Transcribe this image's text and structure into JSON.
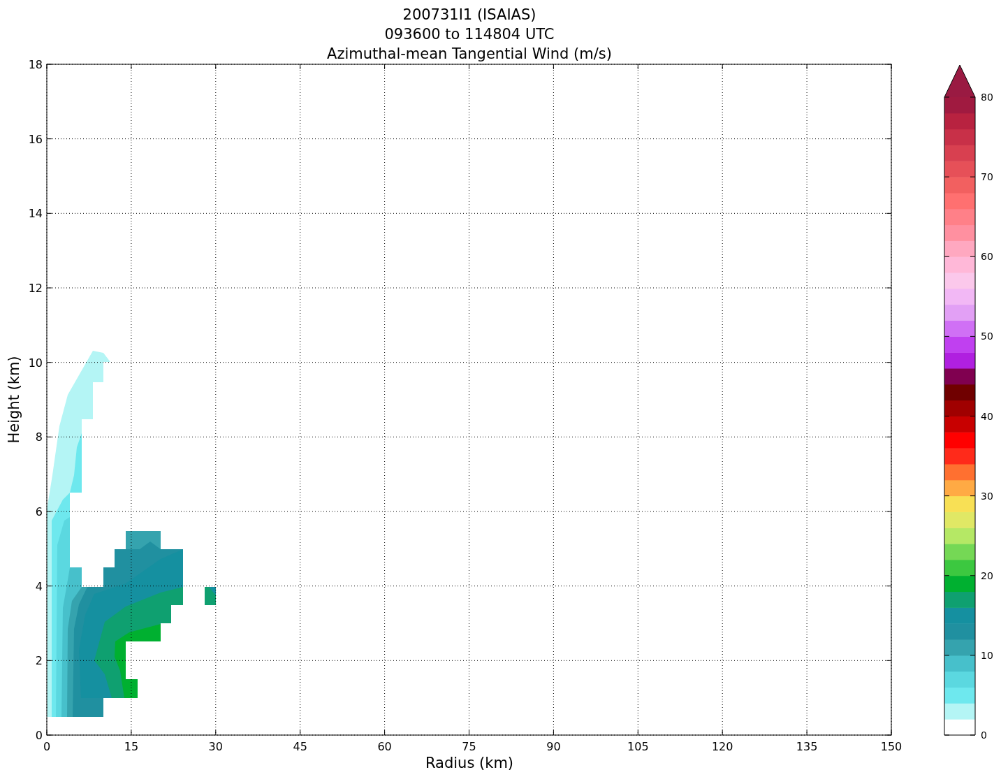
{
  "title_lines": [
    "200731I1 (ISAIAS)",
    "093600 to 114804 UTC",
    "Azimuthal-mean Tangential Wind (m/s)"
  ],
  "xlabel": "Radius (km)",
  "ylabel": "Height (km)",
  "xticks": [
    "0",
    "15",
    "30",
    "45",
    "60",
    "75",
    "90",
    "105",
    "120",
    "135",
    "150"
  ],
  "yticks": [
    "18",
    "16",
    "14",
    "12",
    "10",
    "8",
    "6",
    "4",
    "2",
    "0"
  ],
  "colorbar": {
    "ticks": [
      "80",
      "70",
      "60",
      "50",
      "40",
      "30",
      "20",
      "10",
      "0"
    ],
    "levels": [
      {
        "color": "#ffffff"
      },
      {
        "color": "#b4f5f5"
      },
      {
        "color": "#6ee8ee"
      },
      {
        "color": "#5bd8e0"
      },
      {
        "color": "#47c0cb"
      },
      {
        "color": "#35a3ae"
      },
      {
        "color": "#2090a0"
      },
      {
        "color": "#1590a0"
      },
      {
        "color": "#0fa070"
      },
      {
        "color": "#00b030"
      },
      {
        "color": "#3cc840"
      },
      {
        "color": "#75d855"
      },
      {
        "color": "#b5e865"
      },
      {
        "color": "#e0e865"
      },
      {
        "color": "#f8e055"
      },
      {
        "color": "#ffaa44"
      },
      {
        "color": "#ff7030"
      },
      {
        "color": "#ff2a1a"
      },
      {
        "color": "#ff0000"
      },
      {
        "color": "#c80000"
      },
      {
        "color": "#a00000"
      },
      {
        "color": "#700000"
      },
      {
        "color": "#800050"
      },
      {
        "color": "#b020e0"
      },
      {
        "color": "#c040f0"
      },
      {
        "color": "#d070f5"
      },
      {
        "color": "#e2a0f5"
      },
      {
        "color": "#f2b8f5"
      },
      {
        "color": "#fbc8eb"
      },
      {
        "color": "#ffb8d8"
      },
      {
        "color": "#ffa8c0"
      },
      {
        "color": "#ff90a0"
      },
      {
        "color": "#ff8088"
      },
      {
        "color": "#ff7070"
      },
      {
        "color": "#f26060"
      },
      {
        "color": "#e65058"
      },
      {
        "color": "#d84050"
      },
      {
        "color": "#c83048"
      },
      {
        "color": "#b82240"
      },
      {
        "color": "#a01a40"
      },
      {
        "color": "#9a1a42",
        "kind": "extension"
      }
    ]
  }
}
